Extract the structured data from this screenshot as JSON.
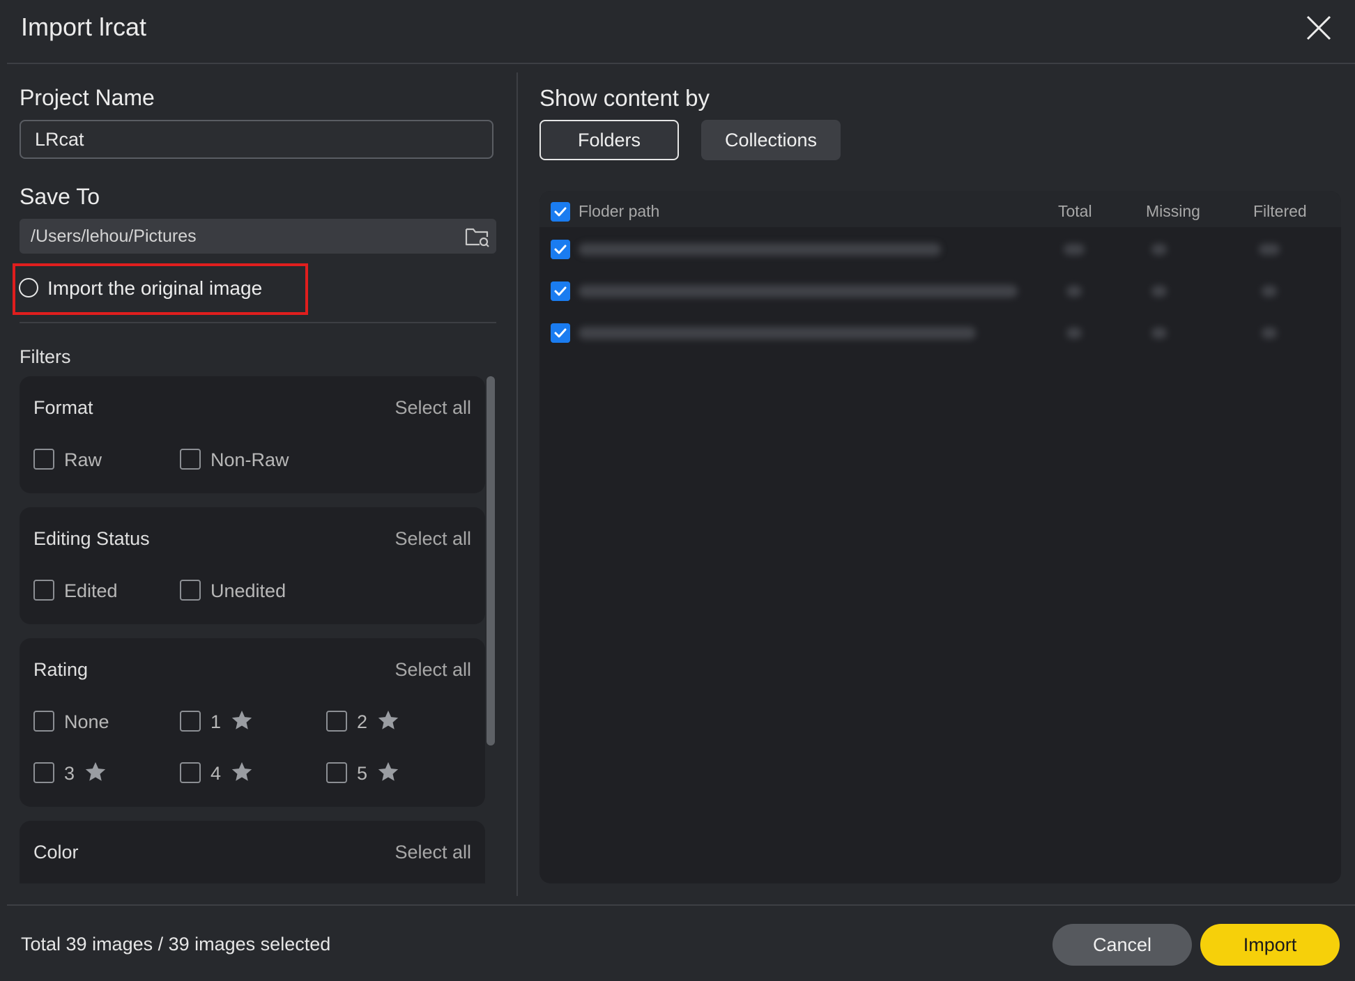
{
  "window": {
    "title": "Import lrcat"
  },
  "left": {
    "project_name_label": "Project Name",
    "project_name_value": "LRcat",
    "save_to_label": "Save To",
    "save_to_path": "/Users/lehou/Pictures",
    "import_original_label": "Import the original image",
    "filters_label": "Filters",
    "select_all_label": "Select all",
    "format": {
      "title": "Format",
      "options": [
        "Raw",
        "Non-Raw"
      ]
    },
    "editing": {
      "title": "Editing Status",
      "options": [
        "Edited",
        "Unedited"
      ]
    },
    "rating": {
      "title": "Rating",
      "none_label": "None",
      "stars": [
        "1",
        "2",
        "3",
        "4",
        "5"
      ]
    },
    "color": {
      "title": "Color"
    }
  },
  "right": {
    "show_label": "Show content by",
    "tabs": [
      "Folders",
      "Collections"
    ],
    "columns": {
      "path": "Floder path",
      "total": "Total",
      "missing": "Missing",
      "filtered": "Filtered"
    }
  },
  "footer": {
    "status": "Total 39 images / 39 images selected",
    "cancel_label": "Cancel",
    "import_label": "Import"
  },
  "colors": {
    "accent": "#f6d00a",
    "checkbox": "#1a7cf0",
    "highlight": "#e01e1e"
  }
}
